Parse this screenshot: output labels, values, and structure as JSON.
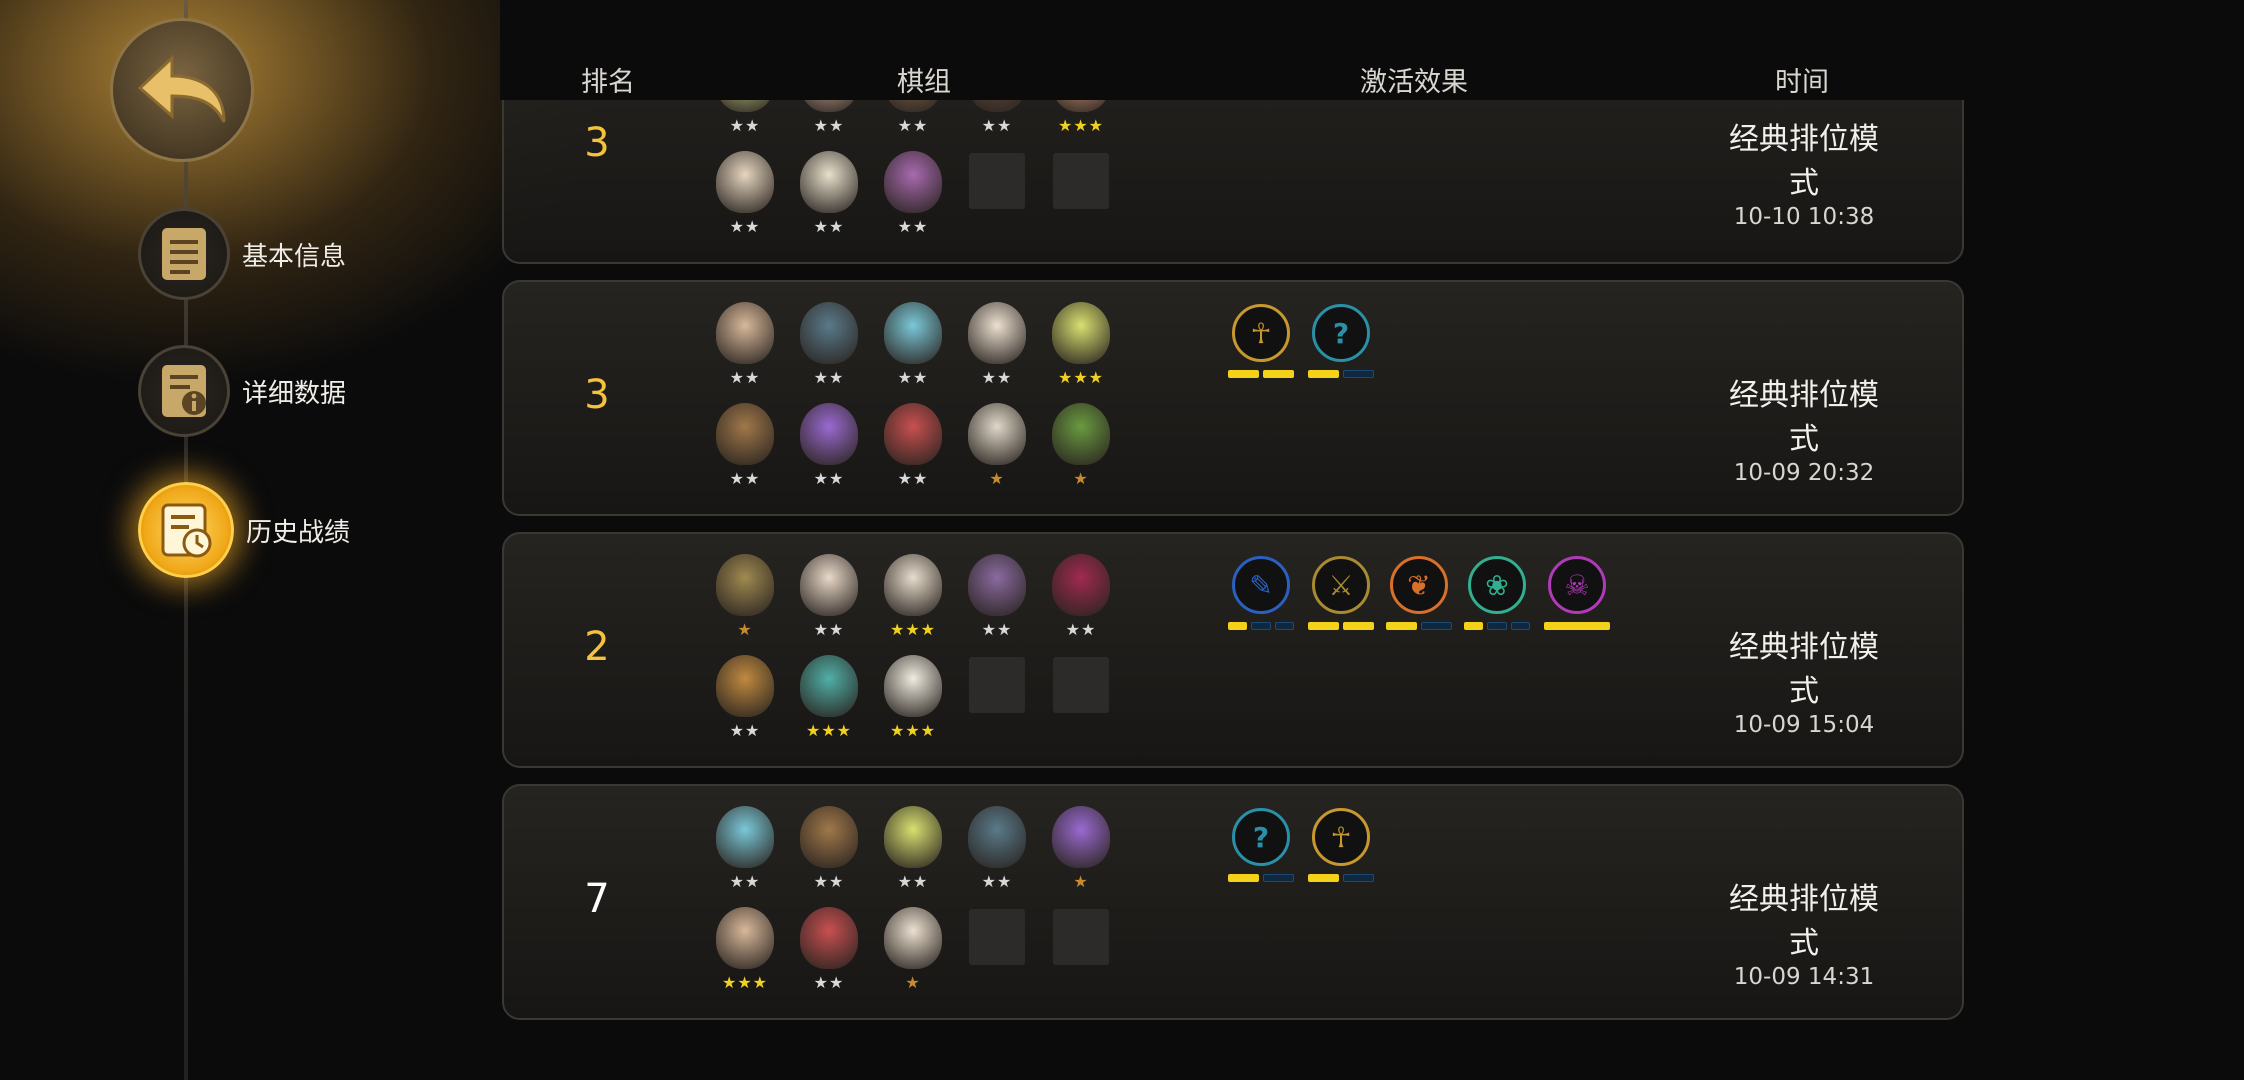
{
  "header": {
    "rank": "排名",
    "lineup": "棋组",
    "effects": "激活效果",
    "time": "时间"
  },
  "nav": {
    "items": [
      {
        "label": "基本信息",
        "icon": "document-icon"
      },
      {
        "label": "详细数据",
        "icon": "stats-info-icon"
      },
      {
        "label": "历史战绩",
        "icon": "history-clock-icon"
      }
    ],
    "active": "历史战绩"
  },
  "colors": {
    "rank_top": "#f5c33b",
    "rank_other": "#ffffff",
    "pip_on": "#f4d21a",
    "pip_off": "#0d2840",
    "star_silver": "#d8d8d8",
    "star_gold": "#f0d020",
    "star_bronze": "#c88a30"
  },
  "matches": [
    {
      "rank": "3",
      "mode": "经典排位模式",
      "time": "10-10 10:38",
      "units": [
        {
          "stars": "★★",
          "star_color": "silver",
          "face": "#c9d48a"
        },
        {
          "stars": "★★",
          "star_color": "silver",
          "face": "#d9b8a0"
        },
        {
          "stars": "★★",
          "star_color": "silver",
          "face": "#8a6a50"
        },
        {
          "stars": "★★",
          "star_color": "silver",
          "face": "#6a5040"
        },
        {
          "stars": "★★★",
          "star_color": "gold",
          "face": "#e0a080"
        },
        {
          "stars": "★★",
          "star_color": "silver",
          "face": "#e6d6c0"
        },
        {
          "stars": "★★",
          "star_color": "silver",
          "face": "#e8e0cc"
        },
        {
          "stars": "★★",
          "star_color": "silver",
          "face": "#a86ab0"
        },
        null,
        null
      ],
      "traits": [
        {
          "symbol": "",
          "border": "#b03ab8",
          "pips": [
            1,
            1
          ]
        },
        {
          "symbol": "",
          "border": "#2a90a8",
          "pips": [
            1,
            0
          ]
        },
        {
          "symbol": "",
          "border": "#3050a0",
          "pips": [
            1,
            1,
            0
          ]
        },
        {
          "symbol": "",
          "border": "#8a6040",
          "pips": [
            1,
            0,
            0
          ]
        },
        {
          "symbol": "",
          "border": "#b03ab8",
          "pips": [
            1
          ]
        }
      ]
    },
    {
      "rank": "3",
      "mode": "经典排位模式",
      "time": "10-09 20:32",
      "units": [
        {
          "stars": "★★",
          "star_color": "silver",
          "face": "#d8b89a"
        },
        {
          "stars": "★★",
          "star_color": "silver",
          "face": "#5a7a8a"
        },
        {
          "stars": "★★",
          "star_color": "silver",
          "face": "#7ac8d8"
        },
        {
          "stars": "★★",
          "star_color": "silver",
          "face": "#ece0d0"
        },
        {
          "stars": "★★★",
          "star_color": "gold",
          "face": "#d8e070"
        },
        {
          "stars": "★★",
          "star_color": "silver",
          "face": "#a0784a"
        },
        {
          "stars": "★★",
          "star_color": "silver",
          "face": "#9a6ad0"
        },
        {
          "stars": "★★",
          "star_color": "silver",
          "face": "#c85050"
        },
        {
          "stars": "★",
          "star_color": "bronze",
          "face": "#e0d8c8"
        },
        {
          "stars": "★",
          "star_color": "bronze",
          "face": "#6a9a40"
        }
      ],
      "traits": [
        {
          "symbol": "☥",
          "border": "#c89830",
          "pips": [
            1,
            1
          ]
        },
        {
          "symbol": "?",
          "border": "#2a90a8",
          "pips": [
            1,
            0
          ]
        }
      ]
    },
    {
      "rank": "2",
      "mode": "经典排位模式",
      "time": "10-09 15:04",
      "units": [
        {
          "stars": "★",
          "star_color": "bronze",
          "face": "#a08a50"
        },
        {
          "stars": "★★",
          "star_color": "silver",
          "face": "#e8d8c8"
        },
        {
          "stars": "★★★",
          "star_color": "gold",
          "face": "#e8dccc"
        },
        {
          "stars": "★★",
          "star_color": "silver",
          "face": "#8a6aa0"
        },
        {
          "stars": "★★",
          "star_color": "silver",
          "face": "#a02a50"
        },
        {
          "stars": "★★",
          "star_color": "silver",
          "face": "#c08a40"
        },
        {
          "stars": "★★★",
          "star_color": "gold",
          "face": "#50b0a8"
        },
        {
          "stars": "★★★",
          "star_color": "gold",
          "face": "#f0ece0"
        },
        null,
        null
      ],
      "traits": [
        {
          "symbol": "✎",
          "border": "#2a60c0",
          "pips": [
            1,
            0,
            0
          ]
        },
        {
          "symbol": "⚔",
          "border": "#a88a30",
          "pips": [
            1,
            1
          ]
        },
        {
          "symbol": "❦",
          "border": "#d8702a",
          "pips": [
            1,
            0
          ]
        },
        {
          "symbol": "❀",
          "border": "#30b090",
          "pips": [
            1,
            0,
            0
          ]
        },
        {
          "symbol": "☠",
          "border": "#b03ab8",
          "pips": [
            1
          ]
        }
      ]
    },
    {
      "rank": "7",
      "mode": "经典排位模式",
      "time": "10-09 14:31",
      "units": [
        {
          "stars": "★★",
          "star_color": "silver",
          "face": "#7ac8d8"
        },
        {
          "stars": "★★",
          "star_color": "silver",
          "face": "#a0784a"
        },
        {
          "stars": "★★",
          "star_color": "silver",
          "face": "#d8e070"
        },
        {
          "stars": "★★",
          "star_color": "silver",
          "face": "#5a7a8a"
        },
        {
          "stars": "★",
          "star_color": "bronze",
          "face": "#9a6ad0"
        },
        {
          "stars": "★★★",
          "star_color": "gold",
          "face": "#d8b89a"
        },
        {
          "stars": "★★",
          "star_color": "silver",
          "face": "#c85050"
        },
        {
          "stars": "★",
          "star_color": "bronze",
          "face": "#ece0d0"
        },
        null,
        null
      ],
      "traits": [
        {
          "symbol": "?",
          "border": "#2a90a8",
          "pips": [
            1,
            0
          ]
        },
        {
          "symbol": "☥",
          "border": "#c89830",
          "pips": [
            1,
            0
          ]
        }
      ]
    }
  ]
}
